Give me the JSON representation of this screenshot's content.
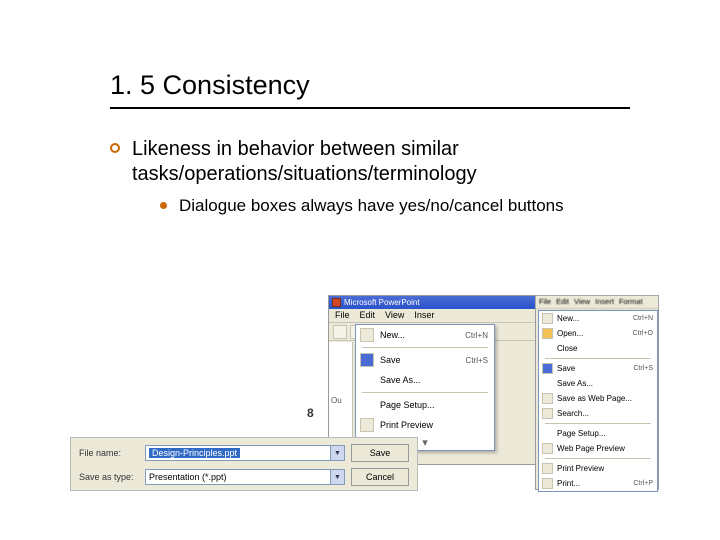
{
  "title": "1. 5 Consistency",
  "l1_text": "Likeness in behavior between similar tasks/operations/situations/terminology",
  "l2_text": "Dialogue boxes always have yes/no/cancel buttons",
  "ppt": {
    "app_title": "Microsoft PowerPoint",
    "menus": {
      "file": "File",
      "edit": "Edit",
      "view": "View",
      "insert": "Inser"
    },
    "file_menu": {
      "new": "New...",
      "new_sc": "Ctrl+N",
      "save": "Save",
      "save_sc": "Ctrl+S",
      "save_as": "Save As...",
      "page_setup": "Page Setup...",
      "print_preview": "Print Preview"
    },
    "outline_tab": "Ou",
    "slide_number": "8"
  },
  "word": {
    "menus": {
      "file": "File",
      "edit": "Edit",
      "view": "View",
      "insert": "Insert",
      "format": "Format"
    },
    "file_menu": {
      "new": "New...",
      "new_sc": "Ctrl+N",
      "open": "Open...",
      "open_sc": "Ctrl+O",
      "close": "Close",
      "save": "Save",
      "save_sc": "Ctrl+S",
      "save_as": "Save As...",
      "save_web": "Save as Web Page...",
      "search": "Search...",
      "page_setup": "Page Setup...",
      "web_preview": "Web Page Preview",
      "print_preview": "Print Preview",
      "print": "Print...",
      "print_sc": "Ctrl+P"
    }
  },
  "save_dialog": {
    "file_name_label": "File name:",
    "file_name_value": "Design-Principles.ppt",
    "save_as_type_label": "Save as type:",
    "save_as_type_value": "Presentation (*.ppt)",
    "save_btn": "Save",
    "cancel_btn": "Cancel"
  }
}
